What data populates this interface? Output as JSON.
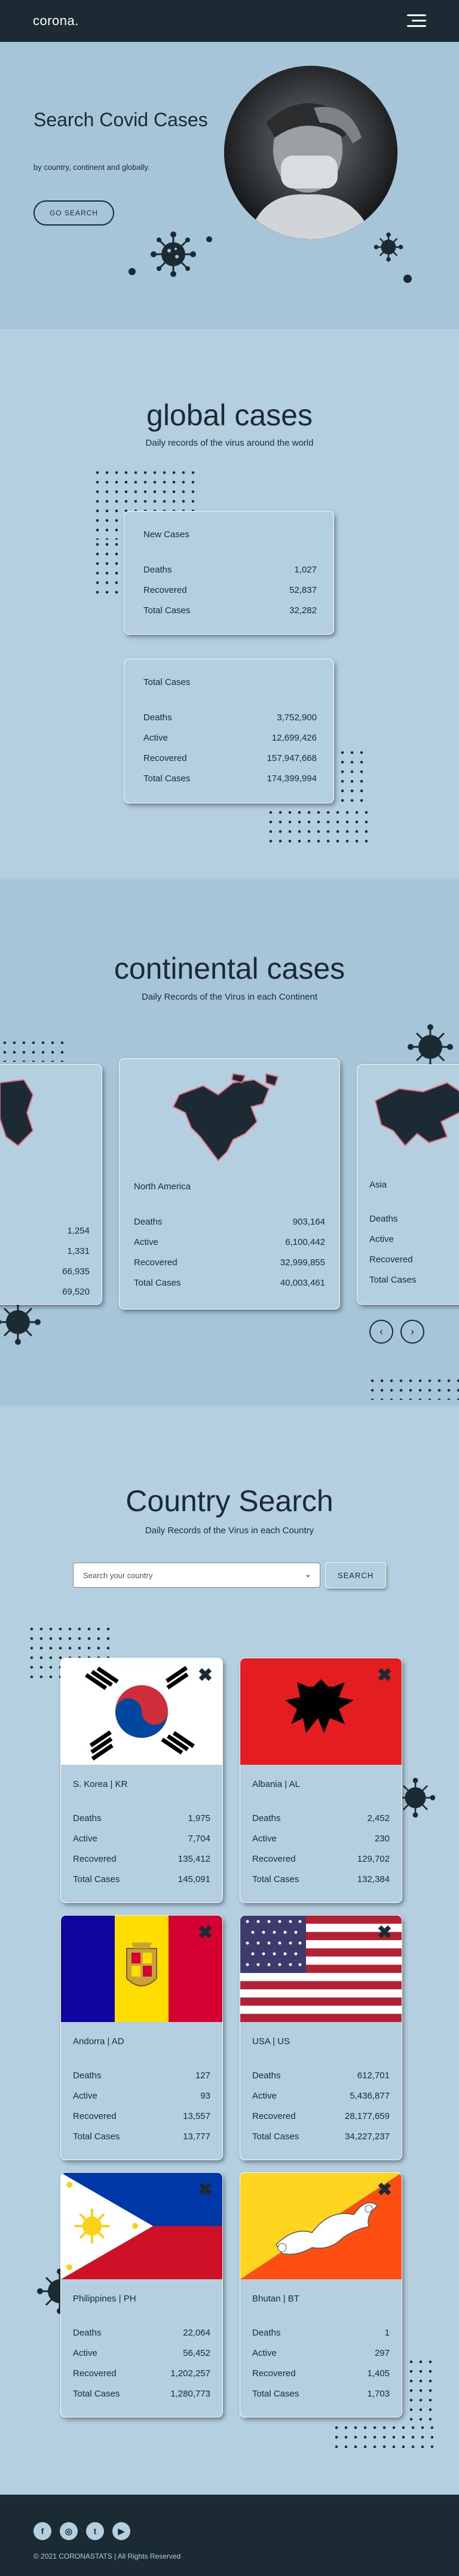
{
  "nav": {
    "logo": "corona."
  },
  "hero": {
    "title": "Search Covid Cases",
    "subtitle": "by country, continent and globally.",
    "button": "GO SEARCH"
  },
  "global": {
    "title": "global cases",
    "subtitle": "Daily records of the virus around the world",
    "new_cases": {
      "heading": "New Cases",
      "rows": [
        {
          "label": "Deaths",
          "value": "1,027"
        },
        {
          "label": "Recovered",
          "value": "52,837"
        },
        {
          "label": "Total Cases",
          "value": "32,282"
        }
      ]
    },
    "total_cases": {
      "heading": "Total Cases",
      "rows": [
        {
          "label": "Deaths",
          "value": "3,752,900"
        },
        {
          "label": "Active",
          "value": "12,699,426"
        },
        {
          "label": "Recovered",
          "value": "157,947,668"
        },
        {
          "label": "Total Cases",
          "value": "174,399,994"
        }
      ]
    }
  },
  "continental": {
    "title": "continental cases",
    "subtitle": "Daily Records of the Virus in each Continent",
    "left_partial": {
      "values": [
        "1,254",
        "1,331",
        "66,935",
        "69,520"
      ]
    },
    "main": {
      "name": "North America",
      "rows": [
        {
          "label": "Deaths",
          "value": "903,164"
        },
        {
          "label": "Active",
          "value": "6,100,442"
        },
        {
          "label": "Recovered",
          "value": "32,999,855"
        },
        {
          "label": "Total Cases",
          "value": "40,003,461"
        }
      ]
    },
    "right_partial": {
      "name": "Asia",
      "labels": [
        "Deaths",
        "Active",
        "Recovered",
        "Total Cases"
      ]
    },
    "prev": "‹",
    "next": "›"
  },
  "country_search": {
    "title": "Country Search",
    "subtitle": "Daily Records of the Virus in each Country",
    "placeholder": "Search your country",
    "button": "SEARCH",
    "countries": [
      {
        "name": "S. Korea | KR",
        "rows": [
          {
            "label": "Deaths",
            "value": "1,975"
          },
          {
            "label": "Active",
            "value": "7,704"
          },
          {
            "label": "Recovered",
            "value": "135,412"
          },
          {
            "label": "Total Cases",
            "value": "145,091"
          }
        ]
      },
      {
        "name": "Albania | AL",
        "rows": [
          {
            "label": "Deaths",
            "value": "2,452"
          },
          {
            "label": "Active",
            "value": "230"
          },
          {
            "label": "Recovered",
            "value": "129,702"
          },
          {
            "label": "Total Cases",
            "value": "132,384"
          }
        ]
      },
      {
        "name": "Andorra | AD",
        "rows": [
          {
            "label": "Deaths",
            "value": "127"
          },
          {
            "label": "Active",
            "value": "93"
          },
          {
            "label": "Recovered",
            "value": "13,557"
          },
          {
            "label": "Total Cases",
            "value": "13,777"
          }
        ]
      },
      {
        "name": "USA | US",
        "rows": [
          {
            "label": "Deaths",
            "value": "612,701"
          },
          {
            "label": "Active",
            "value": "5,436,877"
          },
          {
            "label": "Recovered",
            "value": "28,177,659"
          },
          {
            "label": "Total Cases",
            "value": "34,227,237"
          }
        ]
      },
      {
        "name": "Philippines | PH",
        "rows": [
          {
            "label": "Deaths",
            "value": "22,064"
          },
          {
            "label": "Active",
            "value": "56,452"
          },
          {
            "label": "Recovered",
            "value": "1,202,257"
          },
          {
            "label": "Total Cases",
            "value": "1,280,773"
          }
        ]
      },
      {
        "name": "Bhutan | BT",
        "rows": [
          {
            "label": "Deaths",
            "value": "1"
          },
          {
            "label": "Active",
            "value": "297"
          },
          {
            "label": "Recovered",
            "value": "1,405"
          },
          {
            "label": "Total Cases",
            "value": "1,703"
          }
        ]
      }
    ]
  },
  "footer": {
    "social": [
      "f",
      "◎",
      "t",
      "▶"
    ],
    "social_icons": [
      "facebook-icon",
      "instagram-icon",
      "twitter-icon",
      "youtube-icon"
    ],
    "copyright": "© 2021 CORONASTATS  |  All Rights Reserved"
  },
  "colors": {
    "dark": "#1b2a33",
    "light": "#b3cfe0",
    "hero": "#a6c5d9"
  }
}
